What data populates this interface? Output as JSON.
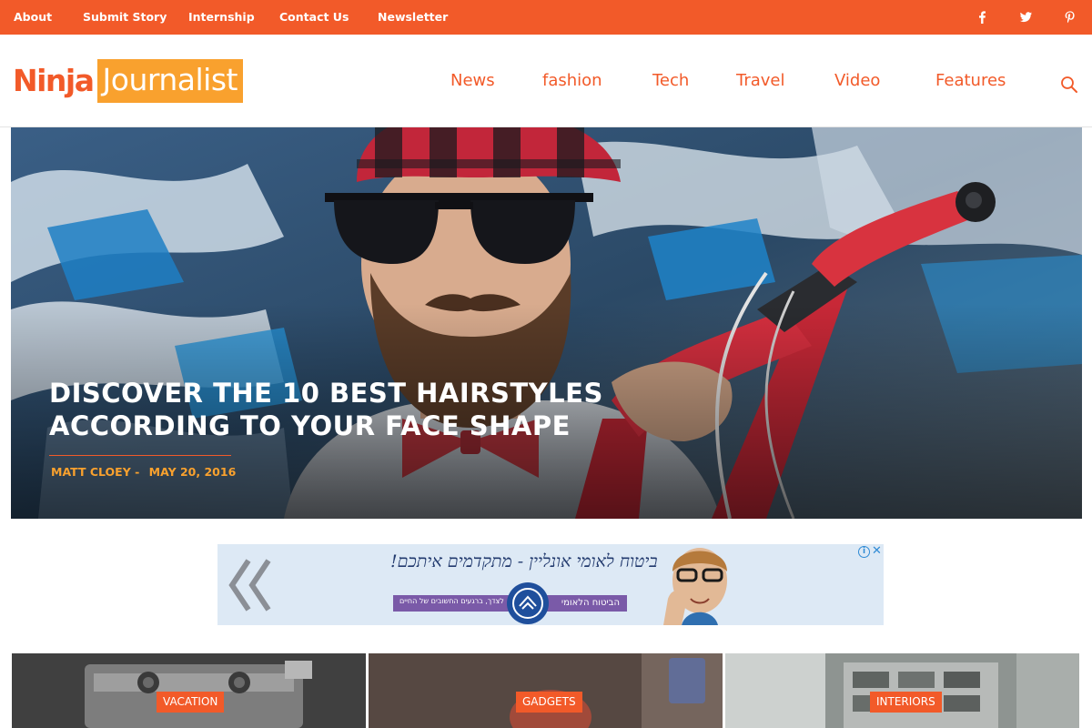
{
  "topbar": {
    "links": [
      "About",
      "Submit Story",
      "Internship",
      "Contact Us",
      "Newsletter"
    ],
    "social": [
      "facebook-icon",
      "twitter-icon",
      "pinterest-icon"
    ],
    "color": "#f25a29"
  },
  "header": {
    "logo_part1": "Ninja",
    "logo_part2": "Journalist",
    "nav": [
      "News",
      "fashion",
      "Tech",
      "Travel",
      "Video",
      "Features"
    ],
    "search_icon": "search-icon",
    "accent": "#f25a29",
    "logo_highlight": "#f9a12e"
  },
  "hero": {
    "title": "DISCOVER THE 10 BEST HAIRSTYLES ACCORDING TO YOUR FACE SHAPE",
    "author": "MATT CLOEY -",
    "date": "MAY 20, 2016"
  },
  "ad": {
    "line1": "ביטוח לאומי אונליין - מתקדמים איתכם!",
    "pill_text": "הביטוח הלאומי",
    "pill_sub": "לצדך, ברגעים החשובים של החיים",
    "info_icon": "info-icon",
    "close_icon": "close-icon"
  },
  "cards": [
    {
      "badge": "VACATION"
    },
    {
      "badge": "GADGETS"
    },
    {
      "badge": "INTERIORS"
    }
  ]
}
